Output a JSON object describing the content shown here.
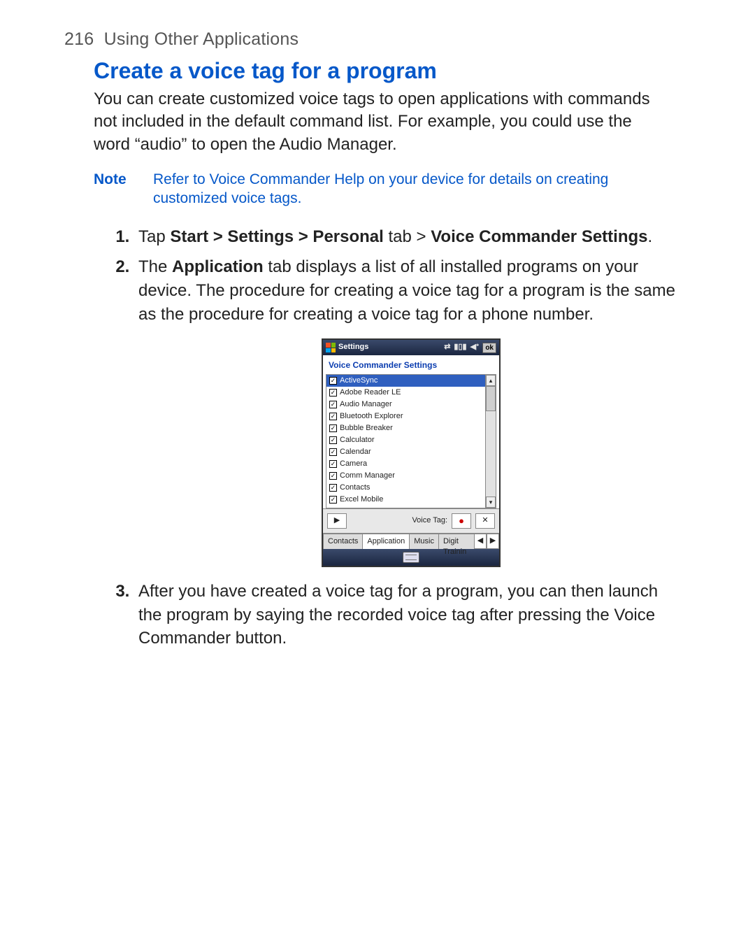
{
  "page": {
    "header_number": "216",
    "header_text": "Using Other Applications",
    "title": "Create a voice tag for a program",
    "intro": "You can create customized voice tags to open applications with commands not included in the default command list.  For example, you could use the word “audio” to open the Audio Manager.",
    "note_label": "Note",
    "note_text": "Refer to  Voice Commander Help on your device for details on creating customized voice tags.",
    "step1_pre": "Tap ",
    "step1_bold1": "Start > Settings > Personal",
    "step1_mid": " tab > ",
    "step1_bold2": "Voice Commander Settings",
    "step1_post": ".",
    "step2_pre": "The ",
    "step2_bold": "Application",
    "step2_post": " tab displays a list of all installed programs on your device. The procedure for creating a voice tag for a program is the same as the procedure for creating a voice tag for a phone number.",
    "step3": "After you have created a voice tag for a program, you can then launch the program by saying the recorded voice tag after pressing the Voice Commander button."
  },
  "device": {
    "titlebar": "Settings",
    "ok": "ok",
    "subheader": "Voice Commander Settings",
    "items": [
      "ActiveSync",
      "Adobe Reader LE",
      "Audio Manager",
      "Bluetooth Explorer",
      "Bubble Breaker",
      "Calculator",
      "Calendar",
      "Camera",
      "Comm Manager",
      "Contacts",
      "Excel Mobile"
    ],
    "voice_tag_label": "Voice Tag:",
    "tabs": [
      "Contacts",
      "Application",
      "Music",
      "Digit Trainin"
    ],
    "scroll_up": "▴",
    "scroll_down": "▾",
    "play": "▶",
    "record": "●",
    "delete": "✕",
    "tab_left": "◀",
    "tab_right": "▶"
  }
}
